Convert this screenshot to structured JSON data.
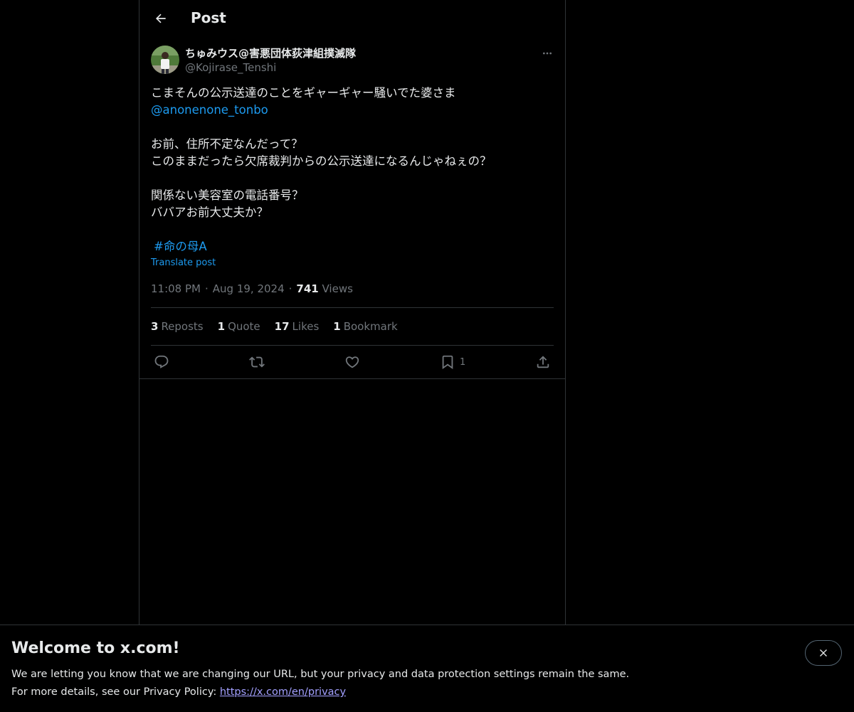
{
  "header": {
    "title": "Post"
  },
  "author": {
    "name": "ちゅみウス@害悪団体荻津組撲滅隊",
    "handle": "@Kojirase_Tenshi"
  },
  "tweet": {
    "line1": "こまそんの公示送達のことをギャーギャー騒いでた婆さま",
    "mention": "@anonenone_tonbo",
    "line3": "お前、住所不定なんだって？",
    "line4": "このままだったら欠席裁判からの公示送達になるんじゃねぇの？",
    "line5": "関係ない美容室の電話番号？",
    "line6": "ババアお前大丈夫か？",
    "hashtag": "#命の母A",
    "translate": "Translate post"
  },
  "meta": {
    "time": "11:08 PM",
    "date": "Aug 19, 2024",
    "views_count": "741",
    "views_label": "Views"
  },
  "stats": {
    "reposts_count": "3",
    "reposts_label": "Reposts",
    "quotes_count": "1",
    "quotes_label": "Quote",
    "likes_count": "17",
    "likes_label": "Likes",
    "bookmarks_count": "1",
    "bookmarks_label": "Bookmark"
  },
  "actions": {
    "bookmark_count": "1",
    "icons": [
      "reply-icon",
      "repost-icon",
      "like-icon",
      "bookmark-icon",
      "share-icon"
    ]
  },
  "banner": {
    "title": "Welcome to x.com!",
    "line1": "We are letting you know that we are changing our URL, but your privacy and data protection settings remain the same.",
    "line2_prefix": "For more details, see our Privacy Policy: ",
    "link": "https://x.com/en/privacy"
  },
  "colors": {
    "background": "#000000",
    "text": "#e7e9ea",
    "secondary": "#71767b",
    "accent": "#1d9bf0",
    "border": "#2f3336"
  }
}
